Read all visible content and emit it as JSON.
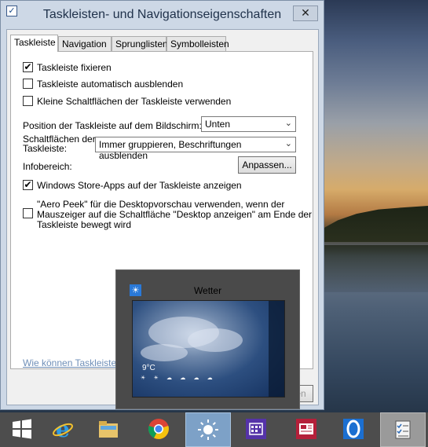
{
  "window": {
    "title": "Taskleisten- und Navigationseigenschaften",
    "close_label": "✕"
  },
  "tabs": [
    {
      "label": "Taskleiste",
      "active": true
    },
    {
      "label": "Navigation",
      "active": false
    },
    {
      "label": "Sprunglisten",
      "active": false
    },
    {
      "label": "Symbolleisten",
      "active": false
    }
  ],
  "settings": {
    "lock_taskbar": {
      "label": "Taskleiste fixieren",
      "checked": true
    },
    "auto_hide": {
      "label": "Taskleiste automatisch ausblenden",
      "checked": false
    },
    "small_buttons": {
      "label": "Kleine Schaltflächen der Taskleiste verwenden",
      "checked": false
    },
    "position": {
      "label": "Position der Taskleiste auf dem Bildschirm:",
      "value": "Unten"
    },
    "buttons": {
      "label_line1": "Schaltflächen der",
      "label_line2": "Taskleiste:",
      "value": "Immer gruppieren, Beschriftungen ausblenden"
    },
    "notification_area": {
      "label": "Infobereich:",
      "button": "Anpassen..."
    },
    "store_apps": {
      "label": "Windows Store-Apps auf der Taskleiste anzeigen",
      "checked": true
    },
    "aero_peek": {
      "line1": "\"Aero Peek\" für die Desktopvorschau verwenden, wenn der",
      "line2": "Mauszeiger auf die Schaltfläche \"Desktop anzeigen\" am Ende der",
      "line3": "Taskleiste bewegt wird",
      "checked": false
    },
    "help_link": "Wie können Taskleisten a",
    "partial_button": "en"
  },
  "preview": {
    "title": "Wetter",
    "temperature": "9°C"
  },
  "taskbar": {
    "items": [
      {
        "name": "start",
        "icon": "windows-logo-icon"
      },
      {
        "name": "internet-explorer",
        "icon": "internet-explorer-icon"
      },
      {
        "name": "file-explorer",
        "icon": "folder-icon"
      },
      {
        "name": "chrome",
        "icon": "chrome-icon"
      },
      {
        "name": "weather",
        "icon": "sun-icon",
        "active": true
      },
      {
        "name": "calendar",
        "icon": "calendar-icon"
      },
      {
        "name": "news",
        "icon": "news-icon"
      },
      {
        "name": "opera",
        "icon": "opera-icon"
      },
      {
        "name": "taskbar-properties",
        "icon": "checklist-icon",
        "pressed": true
      }
    ]
  },
  "colors": {
    "window_frame": "#cdd8e6",
    "taskbar": "#4d4d4d",
    "active_item": "#7da1c7",
    "link": "#6f8fb8"
  }
}
